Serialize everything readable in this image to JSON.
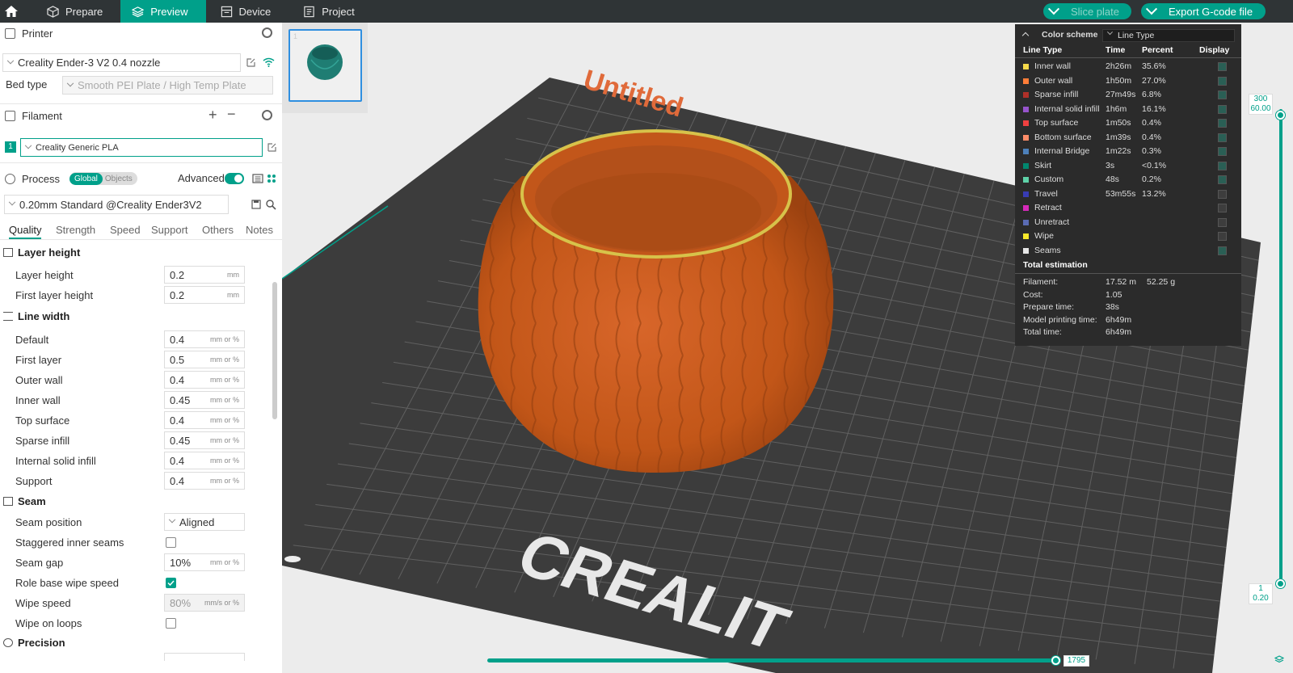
{
  "topbar": {
    "tabs": [
      "Prepare",
      "Preview",
      "Device",
      "Project"
    ],
    "active_tab": "Preview",
    "slice_label": "Slice plate",
    "export_label": "Export G-code file"
  },
  "printer": {
    "section_label": "Printer",
    "name": "Creality Ender-3 V2 0.4 nozzle",
    "bed_type_label": "Bed type",
    "bed_type_value": "Smooth PEI Plate / High Temp Plate"
  },
  "filament": {
    "section_label": "Filament",
    "index": "1",
    "name": "Creality Generic PLA"
  },
  "process": {
    "section_label": "Process",
    "toggle_global": "Global",
    "toggle_objects": "Objects",
    "advanced_label": "Advanced",
    "preset": "0.20mm Standard @Creality Ender3V2",
    "tabs": [
      "Quality",
      "Strength",
      "Speed",
      "Support",
      "Others",
      "Notes"
    ],
    "active_tab": "Quality"
  },
  "settings": {
    "layer_height_group": "Layer height",
    "layer_height": {
      "label": "Layer height",
      "value": "0.2",
      "unit": "mm"
    },
    "first_layer_height": {
      "label": "First layer height",
      "value": "0.2",
      "unit": "mm"
    },
    "line_width_group": "Line width",
    "line_widths": [
      {
        "label": "Default",
        "value": "0.4",
        "unit": "mm or %"
      },
      {
        "label": "First layer",
        "value": "0.5",
        "unit": "mm or %"
      },
      {
        "label": "Outer wall",
        "value": "0.4",
        "unit": "mm or %"
      },
      {
        "label": "Inner wall",
        "value": "0.45",
        "unit": "mm or %"
      },
      {
        "label": "Top surface",
        "value": "0.4",
        "unit": "mm or %"
      },
      {
        "label": "Sparse infill",
        "value": "0.45",
        "unit": "mm or %"
      },
      {
        "label": "Internal solid infill",
        "value": "0.4",
        "unit": "mm or %"
      },
      {
        "label": "Support",
        "value": "0.4",
        "unit": "mm or %"
      }
    ],
    "seam_group": "Seam",
    "seam_position": {
      "label": "Seam position",
      "value": "Aligned"
    },
    "staggered": {
      "label": "Staggered inner seams",
      "checked": false
    },
    "seam_gap": {
      "label": "Seam gap",
      "value": "10%",
      "unit": "mm or %"
    },
    "role_base_wipe": {
      "label": "Role base wipe speed",
      "checked": true
    },
    "wipe_speed": {
      "label": "Wipe speed",
      "value": "80%",
      "unit": "mm/s or %"
    },
    "wipe_on_loops": {
      "label": "Wipe on loops",
      "checked": false
    },
    "precision_group": "Precision"
  },
  "plate": {
    "name": "Untitled",
    "thumb_index": "1"
  },
  "legend": {
    "color_scheme_label": "Color scheme",
    "color_scheme_value": "Line Type",
    "headers": [
      "Line Type",
      "Time",
      "Percent",
      "Display"
    ],
    "rows": [
      {
        "name": "Inner wall",
        "time": "2h26m",
        "percent": "35.6%",
        "color": "#f5d94a",
        "display": true
      },
      {
        "name": "Outer wall",
        "time": "1h50m",
        "percent": "27.0%",
        "color": "#ff7d38",
        "display": true
      },
      {
        "name": "Sparse infill",
        "time": "27m49s",
        "percent": "6.8%",
        "color": "#b03029",
        "display": true
      },
      {
        "name": "Internal solid infill",
        "time": "1h6m",
        "percent": "16.1%",
        "color": "#9654cc",
        "display": true
      },
      {
        "name": "Top surface",
        "time": "1m50s",
        "percent": "0.4%",
        "color": "#f04040",
        "display": true
      },
      {
        "name": "Bottom surface",
        "time": "1m39s",
        "percent": "0.4%",
        "color": "#ff8c68",
        "display": true
      },
      {
        "name": "Internal Bridge",
        "time": "1m22s",
        "percent": "0.3%",
        "color": "#4d80ba",
        "display": true
      },
      {
        "name": "Skirt",
        "time": "3s",
        "percent": "<0.1%",
        "color": "#00876e",
        "display": true
      },
      {
        "name": "Custom",
        "time": "48s",
        "percent": "0.2%",
        "color": "#5ed1a8",
        "display": true
      },
      {
        "name": "Travel",
        "time": "53m55s",
        "percent": "13.2%",
        "color": "#383cb5",
        "display": false
      },
      {
        "name": "Retract",
        "time": "",
        "percent": "",
        "color": "#d62aba",
        "display": false
      },
      {
        "name": "Unretract",
        "time": "",
        "percent": "",
        "color": "#5a6bb3",
        "display": false
      },
      {
        "name": "Wipe",
        "time": "",
        "percent": "",
        "color": "#f7e82b",
        "display": false
      },
      {
        "name": "Seams",
        "time": "",
        "percent": "",
        "color": "#e6e6e6",
        "display": true
      }
    ],
    "total_label": "Total estimation",
    "totals": [
      {
        "label": "Filament:",
        "value": "17.52 m",
        "extra": "52.25 g"
      },
      {
        "label": "Cost:",
        "value": "1.05",
        "extra": ""
      },
      {
        "label": "Prepare time:",
        "value": "38s",
        "extra": ""
      },
      {
        "label": "Model printing time:",
        "value": "6h49m",
        "extra": ""
      },
      {
        "label": "Total time:",
        "value": "6h49m",
        "extra": ""
      }
    ]
  },
  "layer_slider": {
    "top_layer": "300",
    "top_height": "60.00",
    "bottom_layer": "1",
    "bottom_height": "0.20"
  },
  "move_slider": {
    "value": "1795"
  },
  "colors": {
    "accent": "#00a08a",
    "topbar": "#2f3436",
    "bed": "#3a3a3a",
    "model": "#c85a18"
  }
}
